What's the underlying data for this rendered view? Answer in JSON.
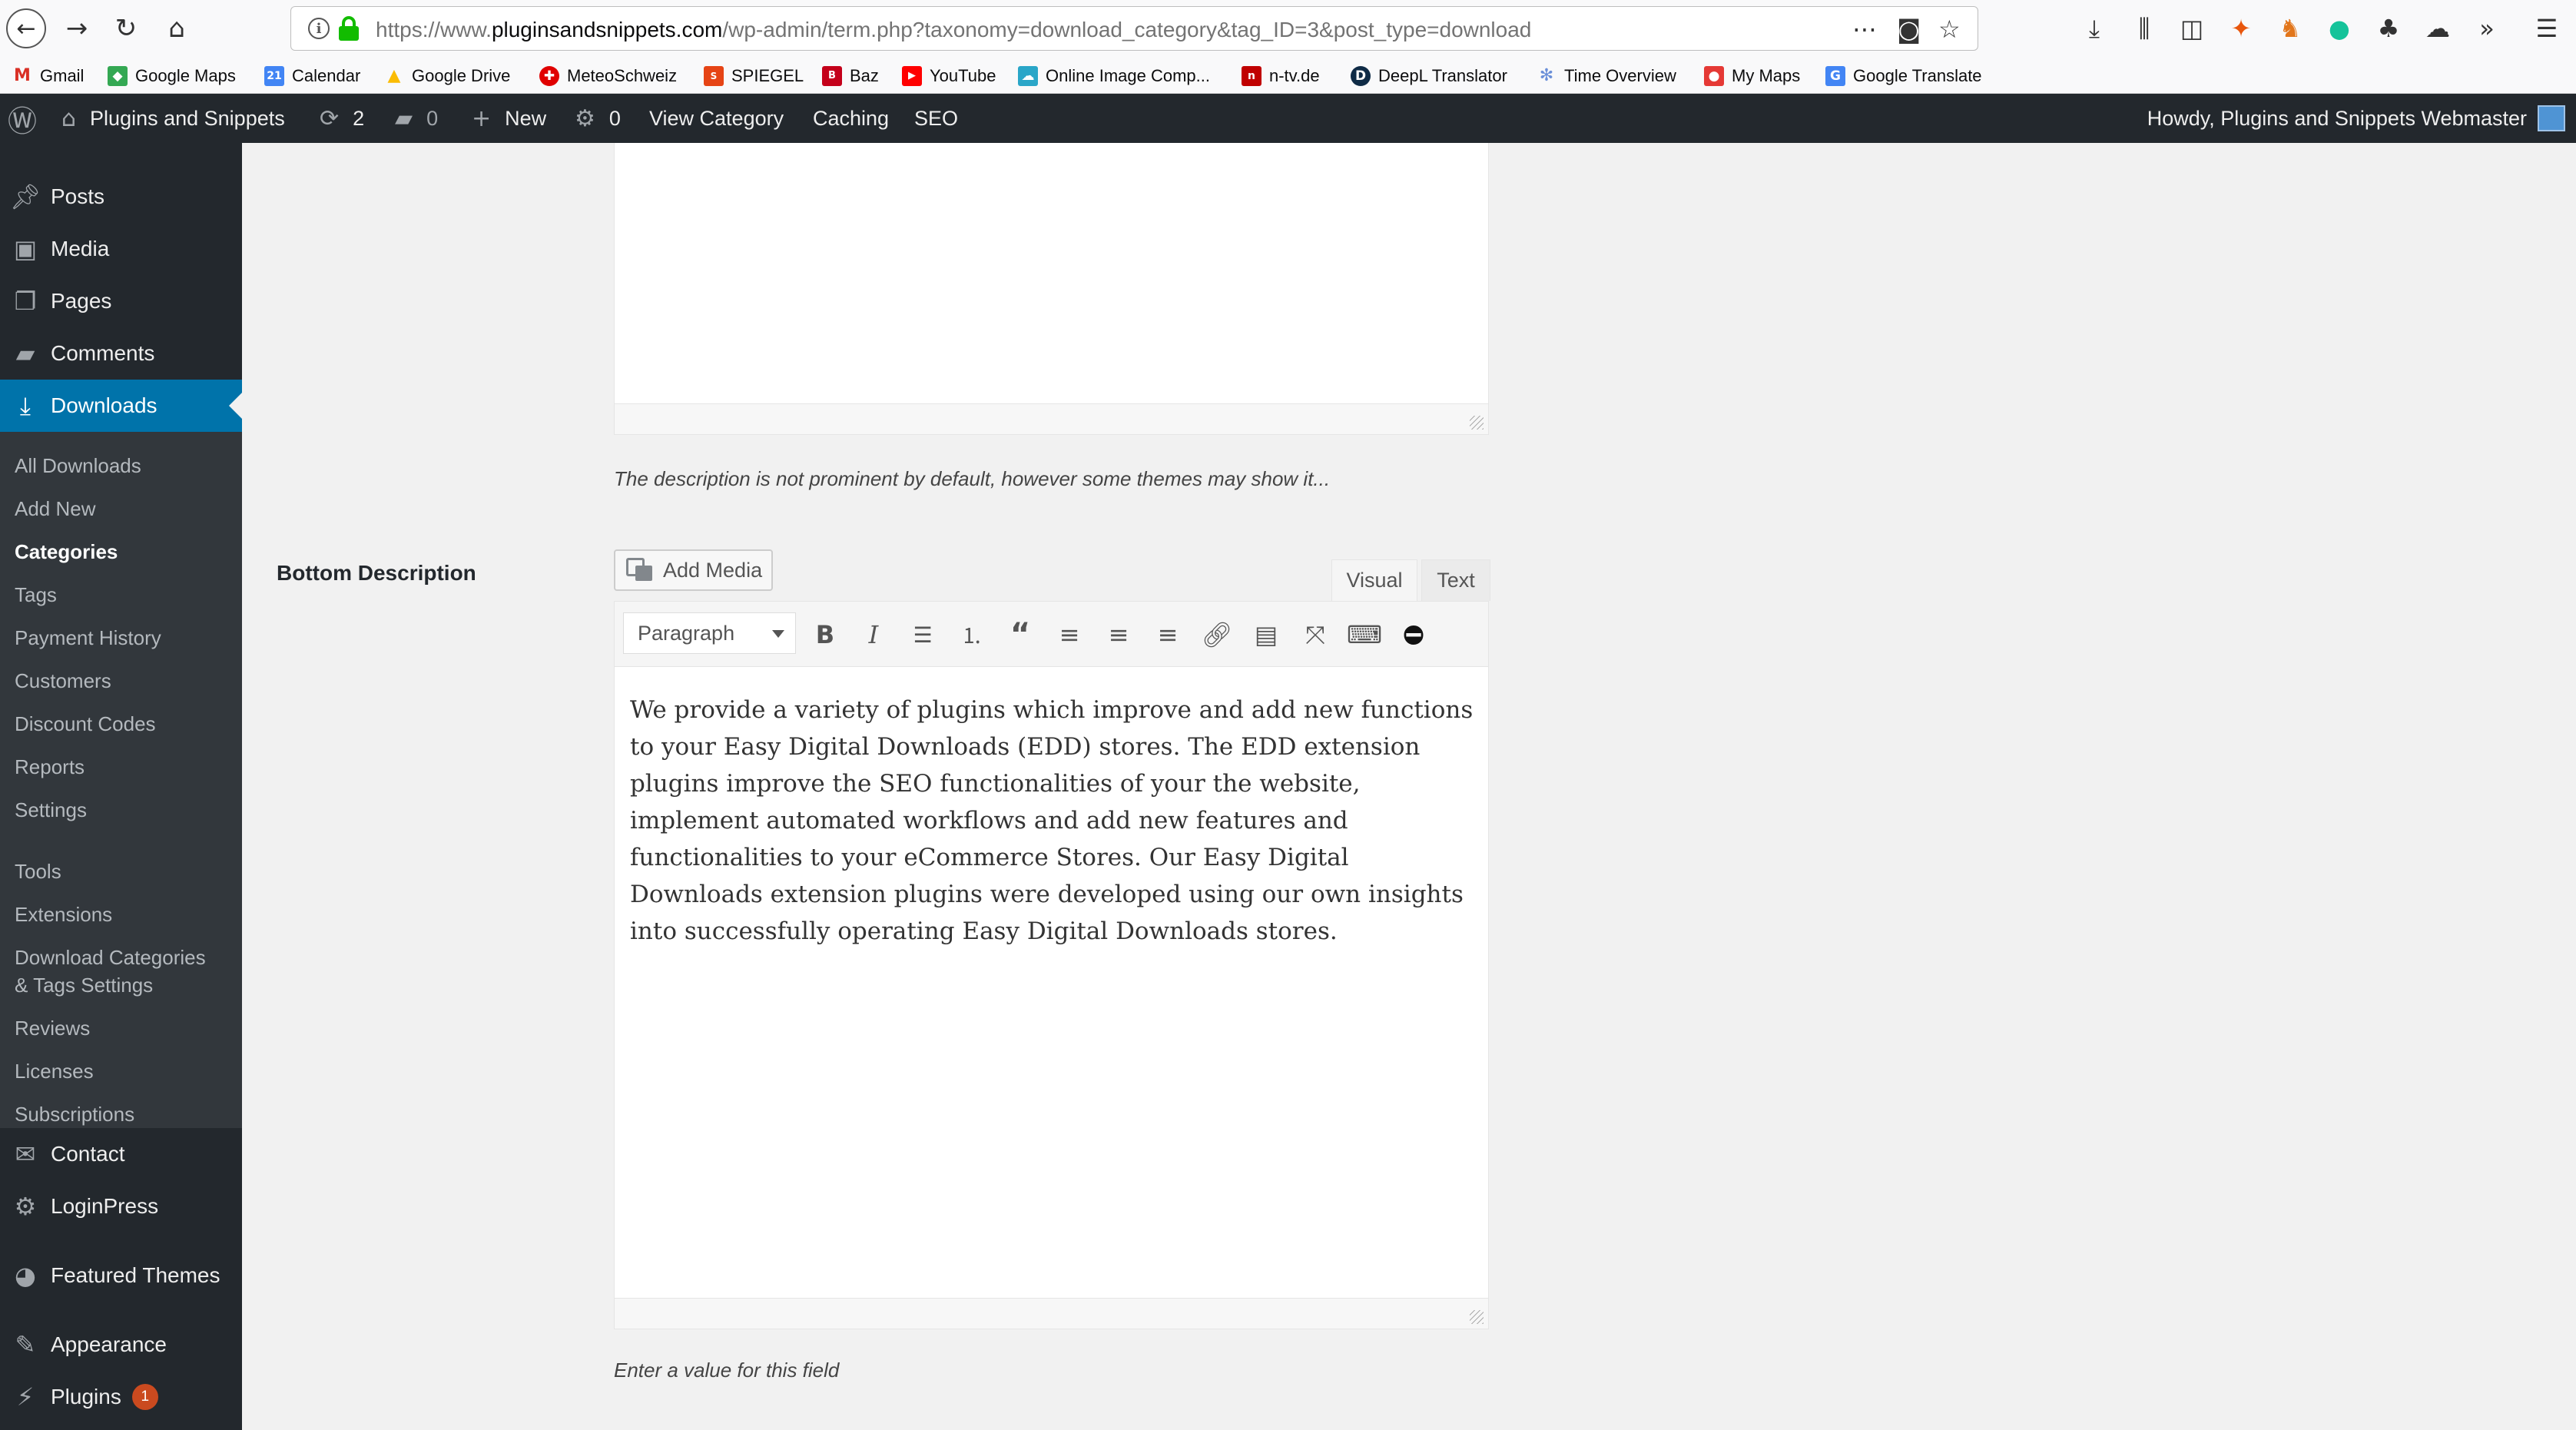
{
  "browser": {
    "url_prefix": "https://www.",
    "url_host": "pluginsandsnippets.com",
    "url_path": "/wp-admin/term.php?taxonomy=download_category&tag_ID=3&post_type=download",
    "icons": [
      "back-arrow-icon",
      "forward-arrow-icon",
      "reload-icon",
      "home-icon",
      "info-icon",
      "lock-icon",
      "page-actions-icon",
      "pocket-icon",
      "star-icon",
      "download-icon",
      "library-icon",
      "sidebar-icon",
      "extension-icon",
      "menu-icon"
    ]
  },
  "bookmarks": [
    {
      "label": "Gmail",
      "icon": "M",
      "color": "#d93025"
    },
    {
      "label": "Google Maps",
      "icon": "◆",
      "color": "#34a853"
    },
    {
      "label": "Calendar",
      "icon": "21",
      "color": "#4285f4"
    },
    {
      "label": "Google Drive",
      "icon": "▲",
      "color": "#fbbc04"
    },
    {
      "label": "MeteoSchweiz",
      "icon": "✚",
      "color": "#e00000"
    },
    {
      "label": "SPIEGEL",
      "icon": "S",
      "color": "#e64415"
    },
    {
      "label": "Baz",
      "icon": "B",
      "color": "#c4001a"
    },
    {
      "label": "YouTube",
      "icon": "▶",
      "color": "#ff0000"
    },
    {
      "label": "Online Image Comp...",
      "icon": "☁",
      "color": "#2aa6c8"
    },
    {
      "label": "n-tv.de",
      "icon": "n",
      "color": "#c00000"
    },
    {
      "label": "DeepL Translator",
      "icon": "D",
      "color": "#0f2b46"
    },
    {
      "label": "Time Overview",
      "icon": "✻",
      "color": "#6a8fd8"
    },
    {
      "label": "My Maps",
      "icon": "●",
      "color": "#e53935"
    },
    {
      "label": "Google Translate",
      "icon": "G",
      "color": "#4285f4"
    }
  ],
  "admin_bar": {
    "site_name": "Plugins and Snippets",
    "updates_count": "2",
    "comments_count": "0",
    "new_label": "New",
    "cache_count": "0",
    "view_category": "View Category",
    "caching": "Caching",
    "seo": "SEO",
    "greeting": "Howdy, Plugins and Snippets Webmaster"
  },
  "sidebar": {
    "top_items": [
      {
        "label": "Posts",
        "icon": "pin-icon"
      },
      {
        "label": "Media",
        "icon": "media-icon"
      },
      {
        "label": "Pages",
        "icon": "pages-icon"
      },
      {
        "label": "Comments",
        "icon": "comments-icon"
      },
      {
        "label": "Downloads",
        "icon": "download-icon"
      }
    ],
    "submenu": [
      "All Downloads",
      "Add New",
      "Categories",
      "Tags",
      "Payment History",
      "Customers",
      "Discount Codes",
      "Reports",
      "Settings",
      "Tools",
      "Extensions",
      "Download Categories",
      "& Tags Settings",
      "Reviews",
      "Licenses",
      "Subscriptions"
    ],
    "bottom_items": [
      {
        "label": "Contact",
        "icon": "mail-icon"
      },
      {
        "label": "LoginPress",
        "icon": "gear-icon"
      },
      {
        "label": "Featured Themes",
        "icon": "globe-icon"
      },
      {
        "label": "Appearance",
        "icon": "brush-icon"
      },
      {
        "label": "Plugins",
        "icon": "plugin-icon",
        "badge": "1"
      }
    ]
  },
  "content": {
    "top_field_description": "The description is not prominent by default, however some themes may show it...",
    "field_label": "Bottom Description",
    "add_media_label": "Add Media",
    "tab_visual": "Visual",
    "tab_text": "Text",
    "format_value": "Paragraph",
    "editor_text": "We provide a variety of plugins which improve and add new functions to your Easy Digital Downloads (EDD) stores. The EDD extension plugins improve the SEO functionalities of your the website, implement automated workflows and add new features and functionalities to your eCommerce Stores. Our Easy Digital Downloads extension plugins were developed using our own insights into successfully operating Easy Digital Downloads stores.",
    "bottom_field_description": "Enter a value for this field"
  },
  "colors": {
    "admin_dark": "#23282d",
    "submenu_dark": "#32373c",
    "accent": "#0073aa",
    "badge": "#ca4a1f"
  }
}
